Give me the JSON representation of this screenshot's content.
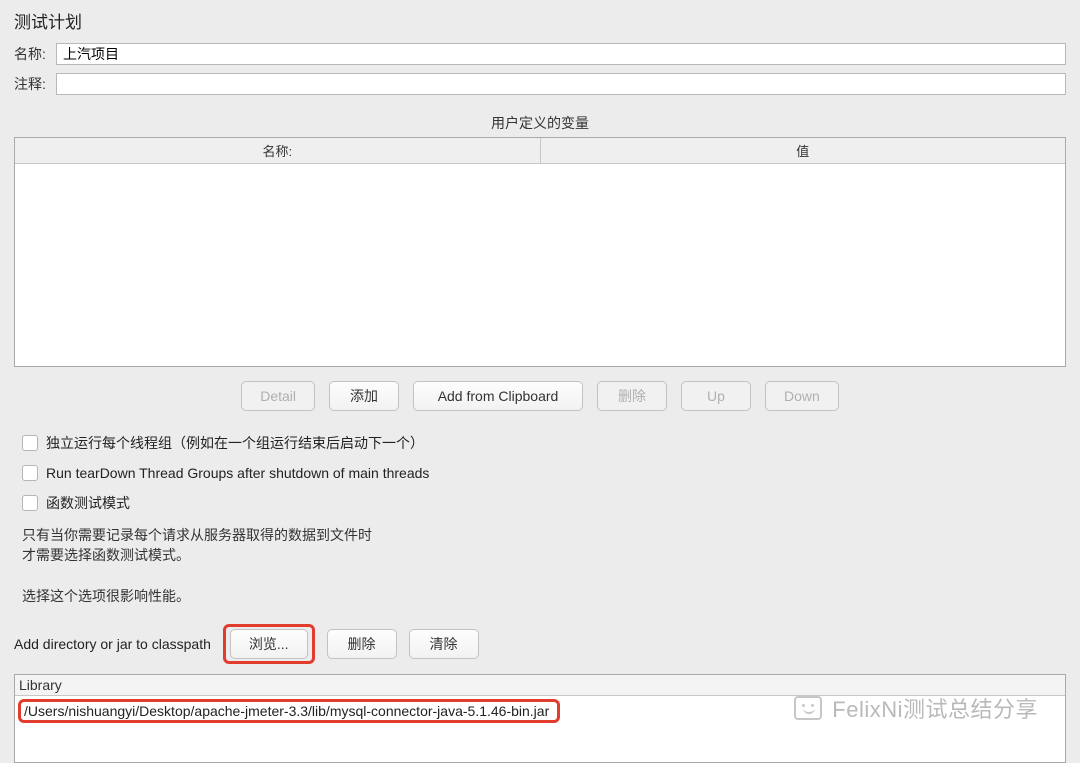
{
  "panel": {
    "title": "测试计划"
  },
  "form": {
    "name_label": "名称:",
    "name_value": "上汽项目",
    "comment_label": "注释:",
    "comment_value": ""
  },
  "vars": {
    "section_title": "用户定义的变量",
    "col_name": "名称:",
    "col_value": "值"
  },
  "buttons": {
    "detail": "Detail",
    "add": "添加",
    "add_clipboard": "Add from Clipboard",
    "delete": "删除",
    "up": "Up",
    "down": "Down"
  },
  "checkboxes": {
    "serial": "独立运行每个线程组（例如在一个组运行结束后启动下一个）",
    "teardown": "Run tearDown Thread Groups after shutdown of main threads",
    "functional": "函数测试模式"
  },
  "help": {
    "line1": "只有当你需要记录每个请求从服务器取得的数据到文件时",
    "line2": "才需要选择函数测试模式。",
    "line3": "选择这个选项很影响性能。"
  },
  "classpath": {
    "label": "Add directory or jar to classpath",
    "browse": "浏览...",
    "delete": "删除",
    "clear": "清除",
    "lib_header": "Library",
    "entries": [
      "/Users/nishuangyi/Desktop/apache-jmeter-3.3/lib/mysql-connector-java-5.1.46-bin.jar"
    ]
  },
  "watermark": "FelixNi测试总结分享"
}
